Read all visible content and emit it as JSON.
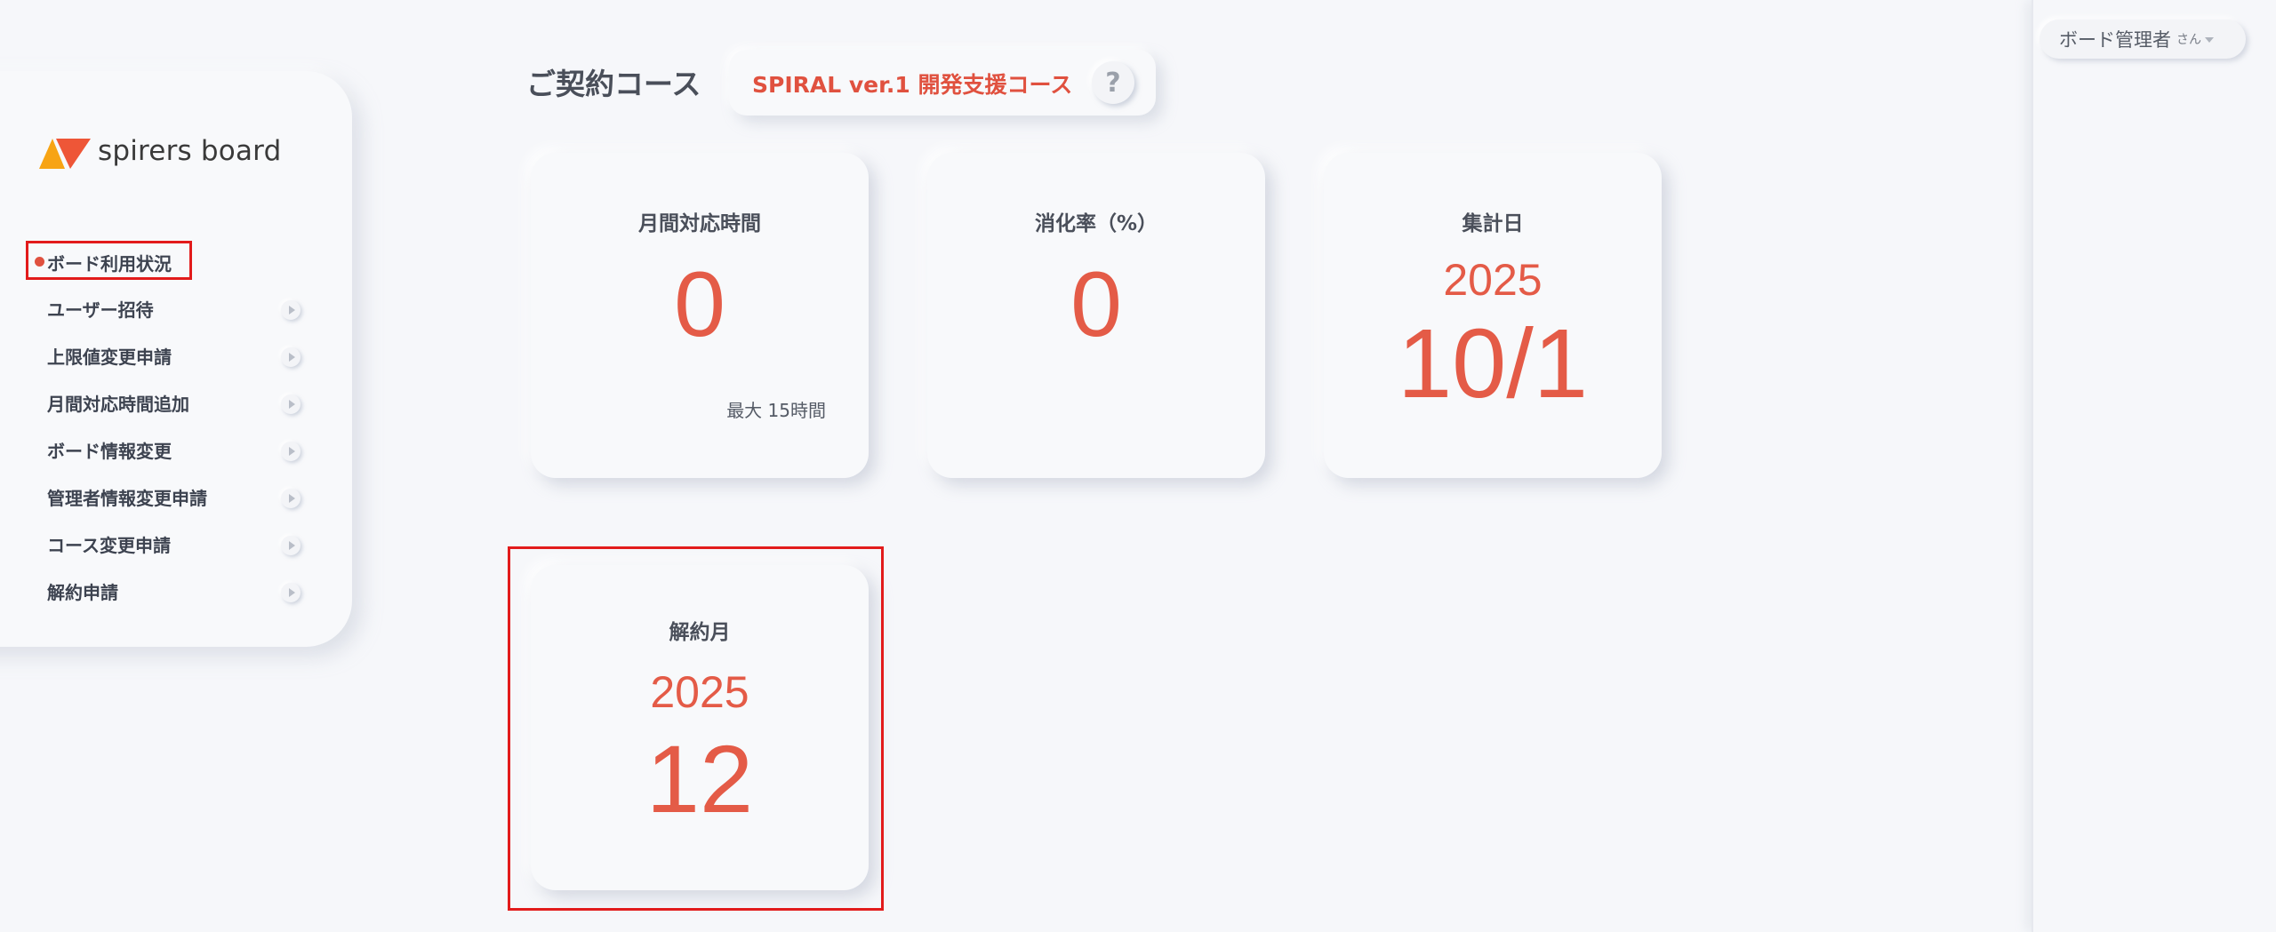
{
  "header": {
    "course_label": "ご契約コース",
    "course_name": "SPIRAL ver.1 開発支援コース",
    "help_icon_text": "?"
  },
  "logo": {
    "text": "spirers board"
  },
  "sidebar": {
    "items": [
      {
        "label": "ボード利用状況",
        "active": true
      },
      {
        "label": "ユーザー招待",
        "active": false
      },
      {
        "label": "上限値変更申請",
        "active": false
      },
      {
        "label": "月間対応時間追加",
        "active": false
      },
      {
        "label": "ボード情報変更",
        "active": false
      },
      {
        "label": "管理者情報変更申請",
        "active": false
      },
      {
        "label": "コース変更申請",
        "active": false
      },
      {
        "label": "解約申請",
        "active": false
      }
    ]
  },
  "cards": {
    "monthly_hours": {
      "label": "月間対応時間",
      "value": "0",
      "sub": "最大 15時間"
    },
    "consumption_rate": {
      "label": "消化率（%）",
      "value": "0"
    },
    "aggregation_date": {
      "label": "集計日",
      "year": "2025",
      "date": "10/1"
    },
    "cancellation_month": {
      "label": "解約月",
      "year": "2025",
      "month": "12"
    }
  },
  "user": {
    "name": "ボード管理者",
    "suffix": "さん"
  },
  "colors": {
    "accent": "#e45b47",
    "highlight_border": "#e21b1b",
    "background": "#f6f7fa"
  }
}
